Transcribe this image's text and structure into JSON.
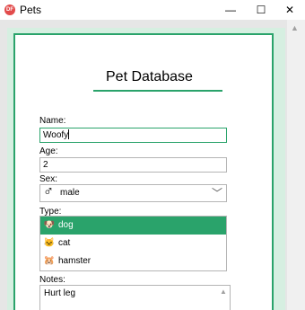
{
  "window": {
    "title": "Pets",
    "app_icon_text": "DF",
    "minimize": "—",
    "maximize": "☐",
    "close": "✕"
  },
  "form": {
    "heading": "Pet Database",
    "name_label": "Name:",
    "name_value": "Woofy",
    "age_label": "Age:",
    "age_value": "2",
    "sex_label": "Sex:",
    "sex_icon": "♂",
    "sex_value": "male",
    "type_label": "Type:",
    "types": [
      {
        "label": "dog",
        "icon": "dog-icon",
        "glyph": "🐶",
        "selected": true
      },
      {
        "label": "cat",
        "icon": "cat-icon",
        "glyph": "🐱",
        "selected": false
      },
      {
        "label": "hamster",
        "icon": "hamster-icon",
        "glyph": "🐹",
        "selected": false
      }
    ],
    "notes_label": "Notes:",
    "notes_value": "Hurt leg"
  },
  "colors": {
    "accent": "#2aa36b",
    "frame": "#d6efe1"
  }
}
